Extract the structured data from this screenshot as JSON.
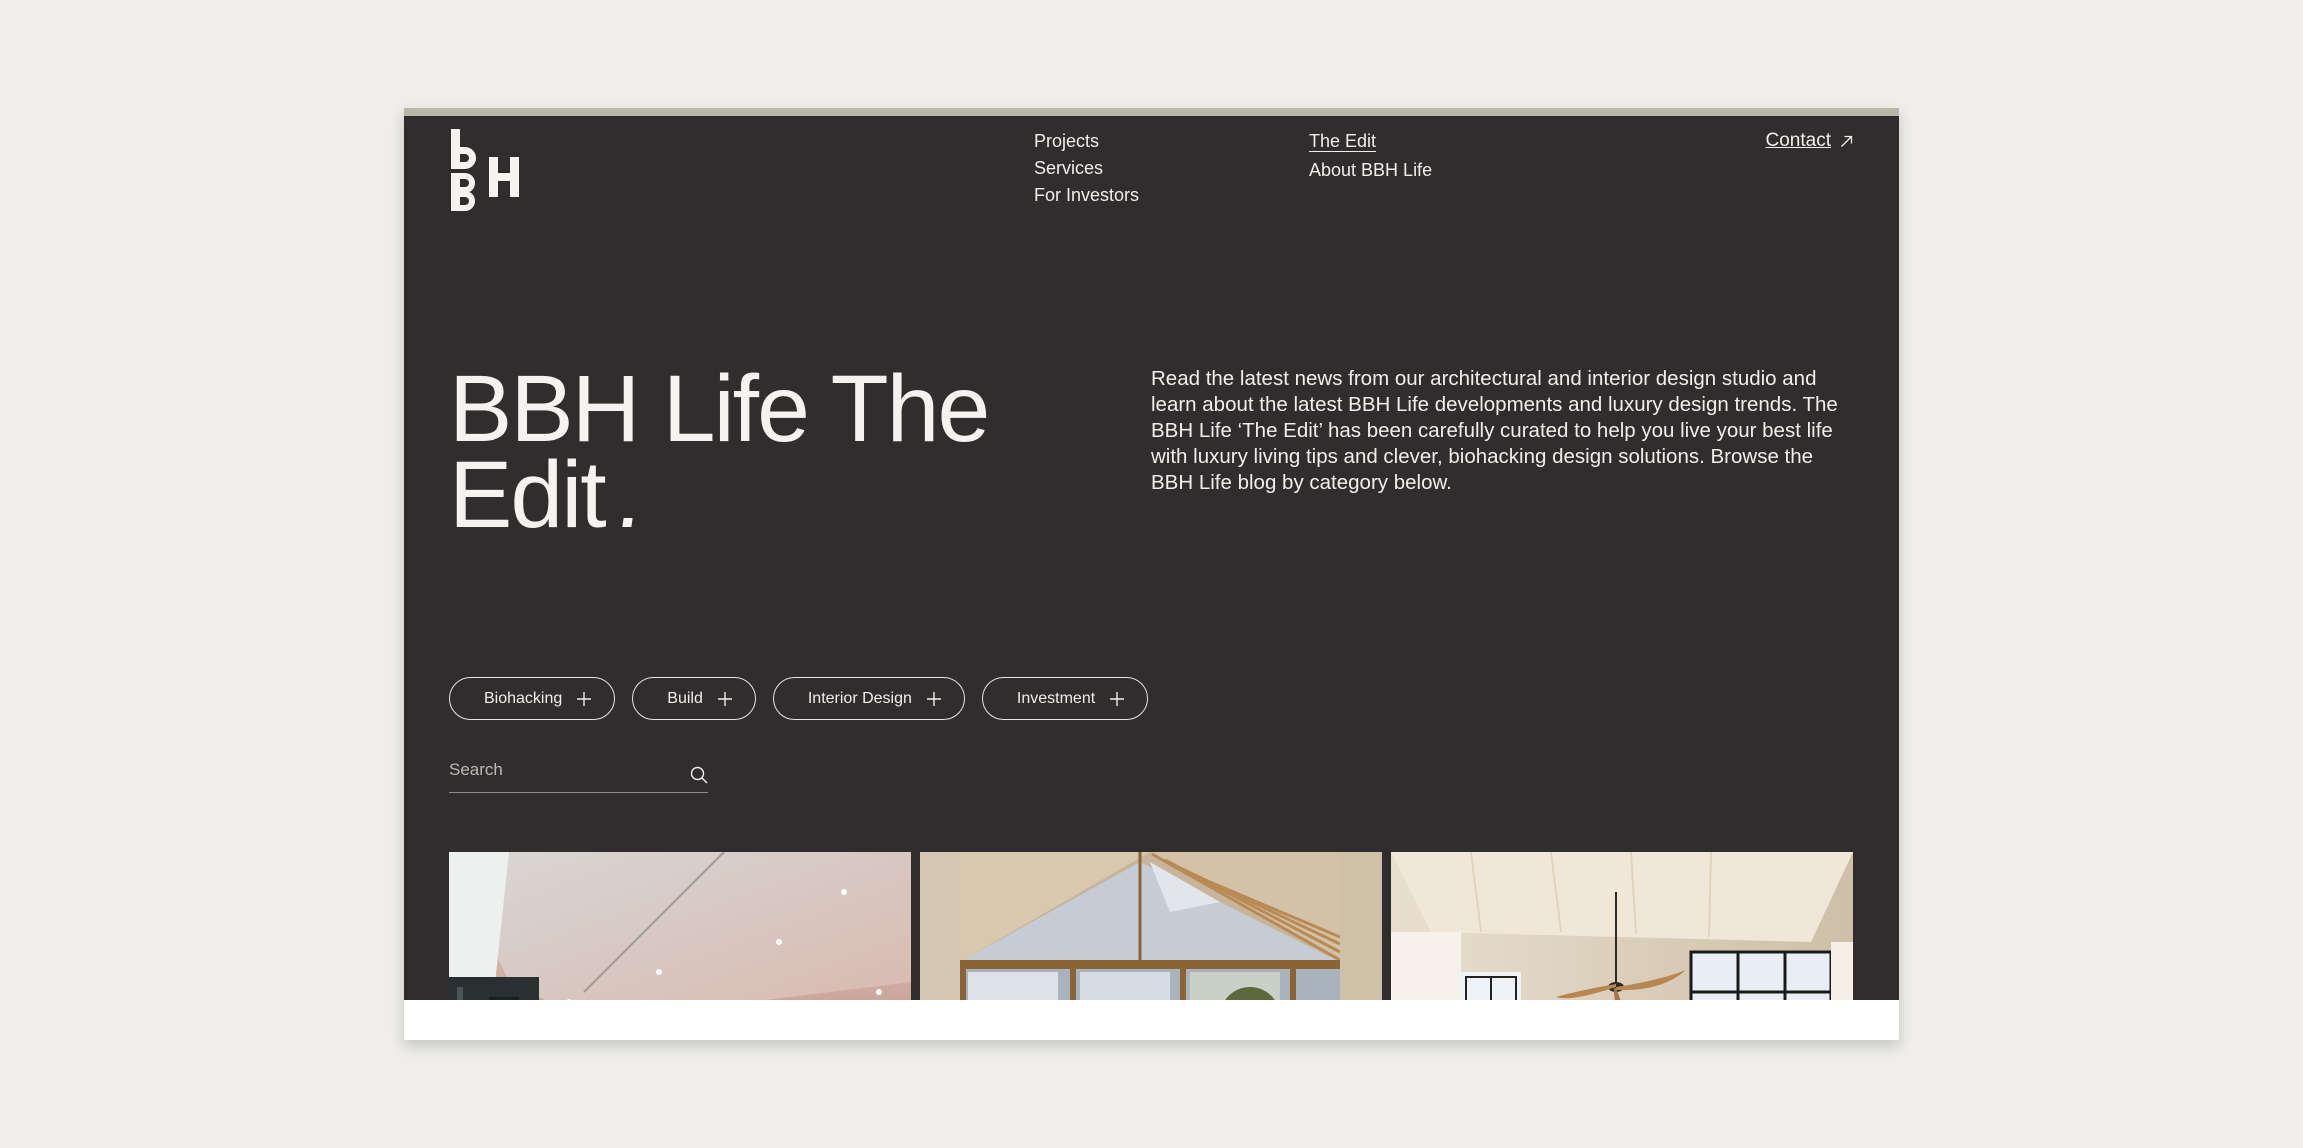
{
  "brand": {
    "logo_text": "BBH"
  },
  "nav": {
    "col1": [
      {
        "label": "Projects"
      },
      {
        "label": "Services"
      },
      {
        "label": "For Investors"
      }
    ],
    "col2": [
      {
        "label": "The Edit",
        "active": true
      },
      {
        "label": "About BBH Life"
      }
    ],
    "contact_label": "Contact"
  },
  "hero": {
    "title": "BBH Life The Edit",
    "intro": "Read the latest news from our architectural and interior design studio and learn about the latest BBH Life developments and luxury design trends. The BBH Life ‘The Edit’ has been carefully curated to help you live your best life with luxury living tips and clever, biohacking design solutions. Browse the BBH Life blog by category below."
  },
  "filters": [
    {
      "label": "Biohacking",
      "icon": "plus-icon"
    },
    {
      "label": "Build",
      "icon": "plus-icon"
    },
    {
      "label": "Interior Design",
      "icon": "plus-icon"
    },
    {
      "label": "Investment",
      "icon": "plus-icon"
    }
  ],
  "search": {
    "placeholder": "Search",
    "value": "",
    "icon": "search-icon"
  },
  "cards": [
    {
      "image": "gym-interior-photo"
    },
    {
      "image": "gabled-window-interior-photo"
    },
    {
      "image": "living-room-ceiling-fan-photo"
    }
  ],
  "colors": {
    "page_bg": "#efeeea",
    "panel_bg": "#312c2d",
    "top_accent": "#b9b6aa",
    "text": "#f2eeea"
  }
}
